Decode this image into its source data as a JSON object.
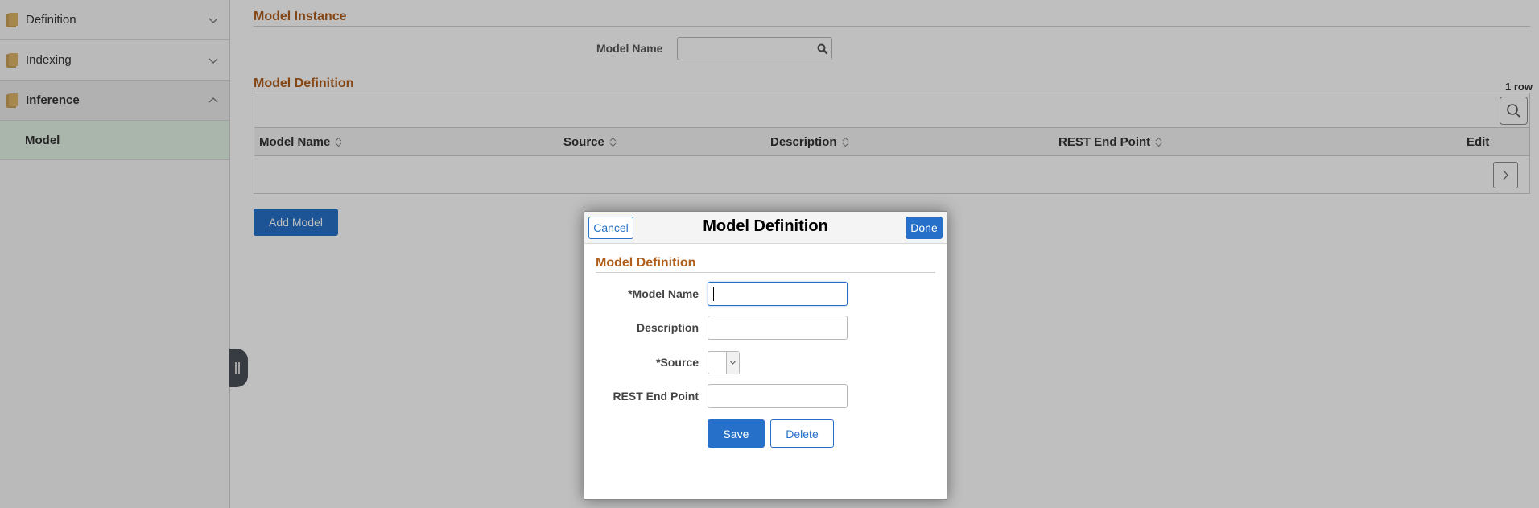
{
  "sidebar": {
    "items": [
      {
        "label": "Definition",
        "icon": "folder-icon",
        "state": "collapsed"
      },
      {
        "label": "Indexing",
        "icon": "folder-icon",
        "state": "collapsed"
      },
      {
        "label": "Inference",
        "icon": "folder-icon",
        "state": "expanded"
      }
    ],
    "sub_items": [
      {
        "label": "Model",
        "selected": true
      }
    ]
  },
  "main": {
    "model_instance": {
      "title": "Model Instance",
      "model_name_label": "Model Name",
      "model_name_value": "",
      "lookup_icon": "search-icon"
    },
    "model_definition": {
      "title": "Model Definition",
      "row_count": "1 row",
      "columns": [
        "Model Name",
        "Source",
        "Description",
        "REST End Point",
        "Edit"
      ],
      "rows": [
        {
          "model_name": "",
          "source": "",
          "description": "",
          "rest_end_point": ""
        }
      ]
    },
    "add_button": "Add Model"
  },
  "modal": {
    "title": "Model Definition",
    "cancel_label": "Cancel",
    "done_label": "Done",
    "section_title": "Model Definition",
    "fields": {
      "model_name": {
        "label": "*Model Name",
        "value": ""
      },
      "description": {
        "label": "Description",
        "value": ""
      },
      "source": {
        "label": "*Source",
        "value": ""
      },
      "rest_end_point": {
        "label": "REST End Point",
        "value": ""
      }
    },
    "save_label": "Save",
    "delete_label": "Delete"
  },
  "colors": {
    "accent": "#2670c9",
    "section_title": "#b05e1c",
    "selected_nav": "#e3f3e6"
  }
}
